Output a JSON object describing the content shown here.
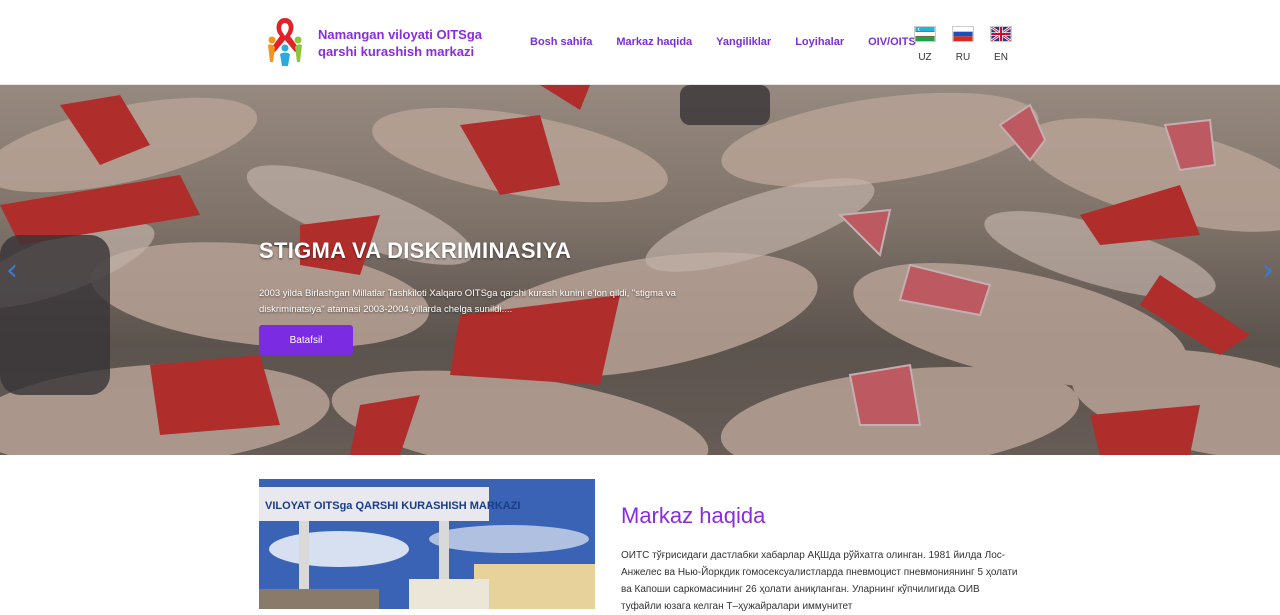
{
  "brand": {
    "name_line1": "Namangan viloyati OITSga",
    "name_line2": "qarshi kurashish markazi"
  },
  "nav": {
    "items": [
      "Bosh sahifa",
      "Markaz haqida",
      "Yangiliklar",
      "Loyihalar",
      "OIV/OITS"
    ]
  },
  "languages": [
    {
      "code": "UZ"
    },
    {
      "code": "RU"
    },
    {
      "code": "EN"
    }
  ],
  "hero": {
    "title": "STIGMA VA DISKRIMINASIYA",
    "text": "2003 yilda Birlashgan Millatlar Tashkiloti Xalqaro OITSga qarshi kurash kunini e'lon qildi, \"stigma va diskriminatsiya\" atamasi 2003-2004 yillarda chelga sunildi....",
    "button": "Batafsil",
    "prev": "‹",
    "next": "›"
  },
  "about": {
    "image_sign": "VILOYAT OITSga QARSHI KURASHISH MARKAZI",
    "title": "Markaz haqida",
    "text": "ОИТС тўғрисидаги дастлабки хабарлар АҚШда рўйхатга олинган. 1981 йилда Лос-Анжелес ва Нью-Йоркдик гомосексуалистларда пневмоцист пневмониянинг 5 ҳолати ва Капоши саркомасининг 26 ҳолати аниқланган. Уларнинг кўпчилигида ОИВ туфайли юзага келган Т–ҳужайралари иммунитет"
  }
}
